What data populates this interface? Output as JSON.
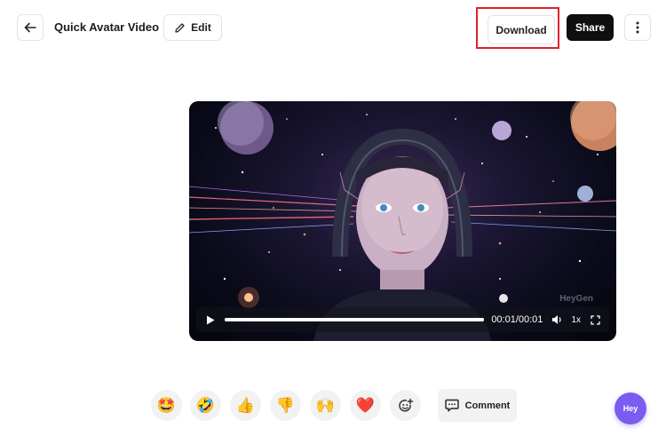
{
  "header": {
    "back_icon": "arrow-left-icon",
    "title": "Quick Avatar Video",
    "edit_label": "Edit",
    "edit_icon": "pencil-icon",
    "download_label": "Download",
    "share_label": "Share",
    "more_icon": "more-vertical-icon"
  },
  "player": {
    "time": "00:01/00:01",
    "speed": "1x",
    "progress": 1.0,
    "watermark": "HeyGen",
    "icons": [
      "play-icon",
      "volume-icon",
      "fullscreen-icon"
    ]
  },
  "reactions": [
    {
      "name": "star-struck",
      "emoji": "🤩"
    },
    {
      "name": "rofl",
      "emoji": "🤣"
    },
    {
      "name": "thumbs-up",
      "emoji": "👍"
    },
    {
      "name": "thumbs-down",
      "emoji": "👎"
    },
    {
      "name": "raised-hands",
      "emoji": "🙌"
    },
    {
      "name": "heart",
      "emoji": "❤️"
    }
  ],
  "add_reaction_icon": "add-emoji-icon",
  "comment_label": "Comment",
  "chat_button_label": "Hey",
  "colors": {
    "highlight": "#e0212b",
    "share_bg": "#0f0f0f",
    "chat_bg": "#7b5cf0"
  }
}
